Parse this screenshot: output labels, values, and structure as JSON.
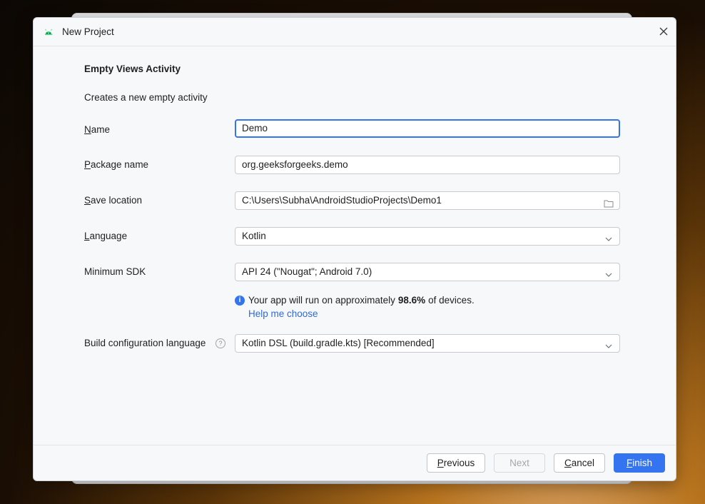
{
  "window": {
    "title": "New Project",
    "close_icon": "close-icon",
    "app_icon": "android-icon"
  },
  "form": {
    "heading": "Empty Views Activity",
    "description": "Creates a new empty activity",
    "name": {
      "label_mnemonic": "N",
      "label_rest": "ame",
      "value": "Demo"
    },
    "package": {
      "label_mnemonic": "P",
      "label_rest": "ackage name",
      "value": "org.geeksforgeeks.demo"
    },
    "save_location": {
      "label_mnemonic": "S",
      "label_rest": "ave location",
      "value": "C:\\Users\\Subha\\AndroidStudioProjects\\Demo1",
      "icon": "folder-icon"
    },
    "language": {
      "label_mnemonic": "L",
      "label_rest": "anguage",
      "value": "Kotlin"
    },
    "min_sdk": {
      "label": "Minimum SDK",
      "value": "API 24 (\"Nougat\"; Android 7.0)"
    },
    "sdk_info": {
      "prefix": "Your app will run on approximately ",
      "percent": "98.6%",
      "suffix": " of devices.",
      "help_link": "Help me choose"
    },
    "build_config": {
      "label": "Build configuration language",
      "help_mark": "?",
      "value": "Kotlin DSL (build.gradle.kts) [Recommended]"
    }
  },
  "footer": {
    "previous": {
      "mnemonic": "P",
      "rest": "revious"
    },
    "next": "Next",
    "cancel": {
      "mnemonic": "C",
      "rest": "ancel"
    },
    "finish": {
      "mnemonic": "F",
      "rest": "inish"
    }
  },
  "colors": {
    "accent": "#3574f0",
    "link": "#2f6ad8",
    "dialog_bg": "#f7f8fa"
  }
}
